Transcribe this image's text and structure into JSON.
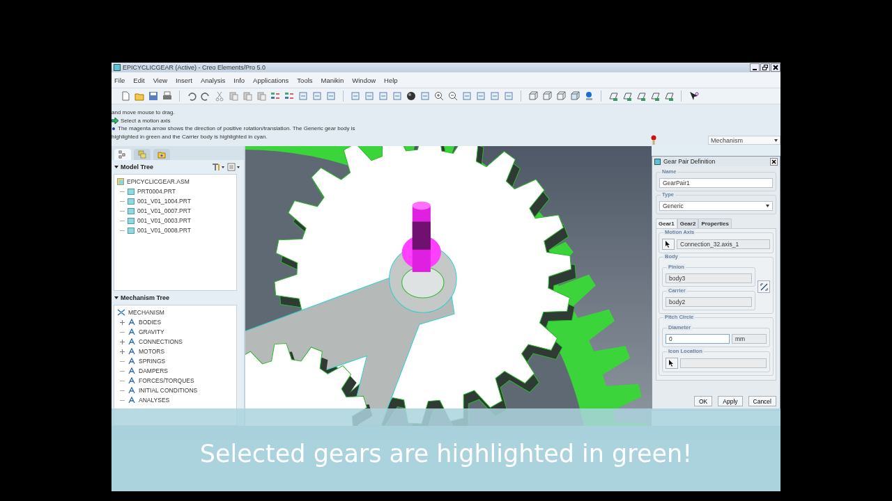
{
  "window": {
    "title": "EPICYCLICGEAR (Active) - Creo Elements/Pro 5.0"
  },
  "menu": [
    "File",
    "Edit",
    "View",
    "Insert",
    "Analysis",
    "Info",
    "Applications",
    "Tools",
    "Manikin",
    "Window",
    "Help"
  ],
  "messages": [
    {
      "kind": "plain",
      "text": "and move mouse to drag."
    },
    {
      "kind": "prompt",
      "text": "Select a motion axis"
    },
    {
      "kind": "info",
      "text": "The magenta arrow shows the direction of positive rotation/translation. The Generic gear body is"
    },
    {
      "kind": "plain",
      "text": "highlighted in green and the Carrier body is highlighted in cyan."
    }
  ],
  "mode_select": {
    "value": "Mechanism"
  },
  "panel_tabs": [
    {
      "selected": true
    },
    {
      "selected": false
    },
    {
      "selected": false
    }
  ],
  "model_tree": {
    "title": "Model Tree",
    "items": [
      {
        "label": "EPICYCLICGEAR.ASM",
        "children": [
          {
            "label": "PRT0004.PRT"
          },
          {
            "label": "001_V01_1004.PRT"
          },
          {
            "label": "001_V01_0007.PRT"
          },
          {
            "label": "001_V01_0003.PRT"
          },
          {
            "label": "001_V01_0008.PRT"
          }
        ]
      }
    ]
  },
  "mechanism_tree": {
    "title": "Mechanism Tree",
    "items": [
      {
        "label": "MECHANISM",
        "children": [
          {
            "label": "BODIES",
            "expandable": true
          },
          {
            "label": "GRAVITY",
            "expandable": false
          },
          {
            "label": "CONNECTIONS",
            "expandable": true
          },
          {
            "label": "MOTORS",
            "expandable": true
          },
          {
            "label": "SPRINGS",
            "expandable": false
          },
          {
            "label": "DAMPERS",
            "expandable": false
          },
          {
            "label": "FORCES/TORQUES",
            "expandable": false
          },
          {
            "label": "INITIAL CONDITIONS",
            "expandable": false
          },
          {
            "label": "ANALYSES",
            "expandable": false
          }
        ]
      }
    ]
  },
  "dialog": {
    "title": "Gear Pair Definition",
    "name_label": "Name",
    "name_value": "GearPair1",
    "type_label": "Type",
    "type_value": "Generic",
    "tabs": [
      {
        "label": "Gear1",
        "selected": true
      },
      {
        "label": "Gear2",
        "selected": false
      },
      {
        "label": "Properties",
        "selected": false
      }
    ],
    "motion_axis_label": "Motion Axis",
    "motion_axis_value": "Connection_32.axis_1",
    "body_label": "Body",
    "pinion_label": "Pinion",
    "pinion_value": "body3",
    "carrier_label": "Carrier",
    "carrier_value": "body2",
    "pitch_label": "Pitch Circle",
    "diameter_label": "Diameter",
    "diameter_value": "0",
    "unit": "mm",
    "icon_location_label": "Icon Location",
    "buttons": [
      "OK",
      "Apply",
      "Cancel"
    ]
  },
  "caption": "Selected gears are highlighted in green!"
}
